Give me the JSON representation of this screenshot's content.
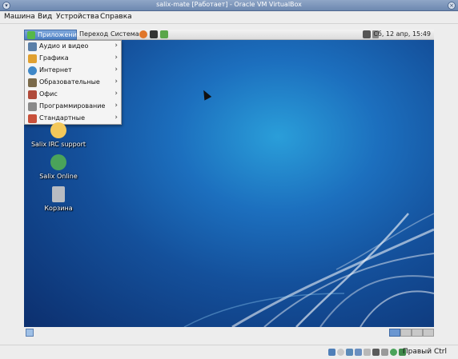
{
  "window": {
    "title": "salix-mate [Работает] - Oracle VM VirtualBox"
  },
  "host_menu": {
    "items": [
      "Машина",
      "Вид",
      "Устройства",
      "Справка"
    ]
  },
  "guest_panel": {
    "applications_label": "Приложения",
    "places_label": "Переход",
    "system_label": "Система",
    "clock": "Сб, 12 апр, 15:49",
    "launcher_icons": [
      "firefox-icon",
      "terminal-icon",
      "edit-icon"
    ],
    "tray_icons": [
      "network-icon",
      "volume-icon"
    ]
  },
  "app_menu": {
    "items": [
      {
        "label": "Аудио и видео",
        "icon": "multimedia-icon",
        "color": "#5a7fa8"
      },
      {
        "label": "Графика",
        "icon": "graphics-icon",
        "color": "#e0a030"
      },
      {
        "label": "Интернет",
        "icon": "internet-icon",
        "color": "#3f88c8"
      },
      {
        "label": "Образовательные",
        "icon": "education-icon",
        "color": "#7a6a4a"
      },
      {
        "label": "Офис",
        "icon": "office-icon",
        "color": "#b04a3a"
      },
      {
        "label": "Программирование",
        "icon": "programming-icon",
        "color": "#8a8a8a"
      },
      {
        "label": "Стандартные",
        "icon": "accessories-icon",
        "color": "#c8503a"
      }
    ]
  },
  "desktop_icons": [
    {
      "label": "Salix IRC support",
      "icon": "irc-chat-icon"
    },
    {
      "label": "Salix Online",
      "icon": "globe-icon"
    },
    {
      "label": "Корзина",
      "icon": "trash-icon"
    }
  ],
  "status_bar": {
    "host_key_label": "Правый Ctrl",
    "icons": [
      "hdd-icon",
      "cd-icon",
      "usb-icon",
      "shared-folder-icon",
      "display-icon",
      "network-icon",
      "recording-icon",
      "virtualization-icon",
      "mouse-integration-icon"
    ]
  },
  "colors": {
    "desktop_center": "#2a9ed9",
    "desktop_edge": "#0c2f6e",
    "menu_highlight": "#4d80c4"
  }
}
